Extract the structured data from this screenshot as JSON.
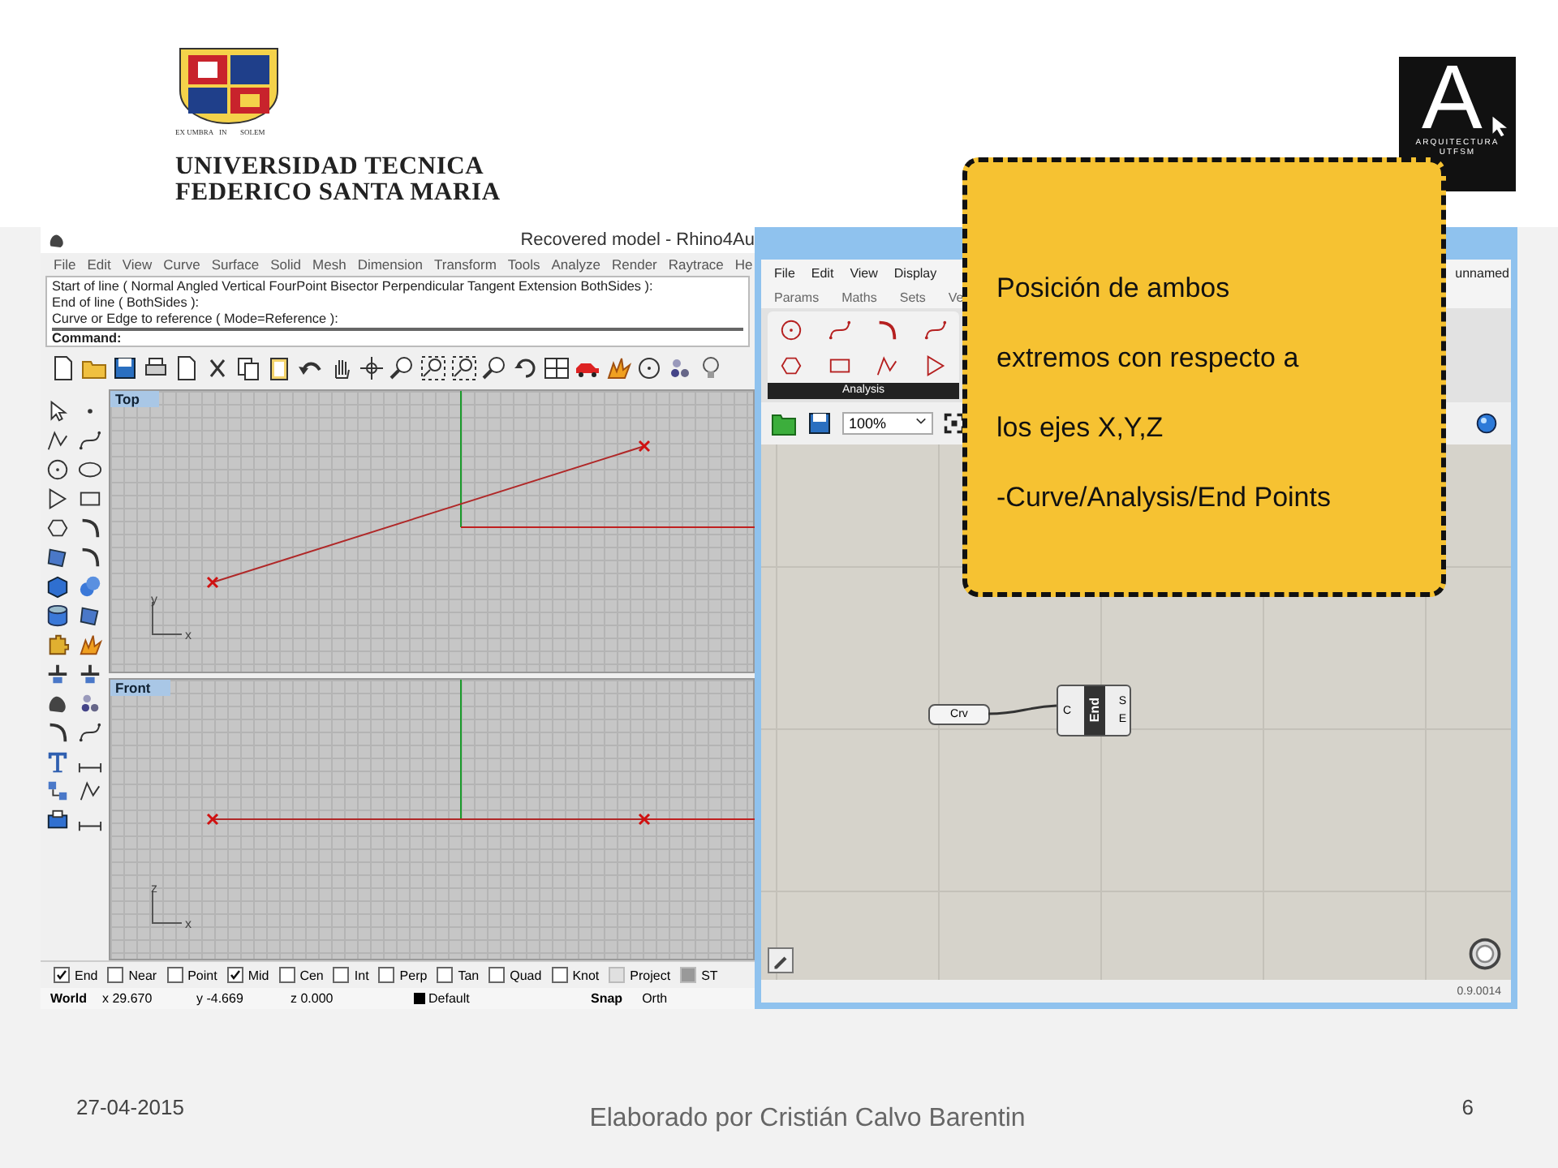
{
  "header": {
    "university_logo": {
      "motto": [
        "EX UMBRA",
        "IN",
        "SOLEM"
      ],
      "lines": [
        "UNIVERSIDAD TECNICA",
        "FEDERICO SANTA MARIA"
      ]
    },
    "school_logo": {
      "letter": "A",
      "lines": [
        "ARQUITECTURA",
        "UTFSM"
      ]
    }
  },
  "rhino": {
    "title": "Recovered model - Rhino4Au",
    "menu": [
      "File",
      "Edit",
      "View",
      "Curve",
      "Surface",
      "Solid",
      "Mesh",
      "Dimension",
      "Transform",
      "Tools",
      "Analyze",
      "Render",
      "Raytrace",
      "He"
    ],
    "command_history": [
      "Start of line ( Normal  Angled  Vertical  FourPoint  Bisector  Perpendicular  Tangent  Extension  BothSides ):",
      "End of line ( BothSides ):",
      "Curve or Edge to reference ( Mode=Reference ):"
    ],
    "command_prompt": "Command:",
    "viewports": [
      {
        "kind": "top",
        "label": "Top",
        "axis_labels": [
          "y",
          "x"
        ]
      },
      {
        "kind": "front",
        "label": "Front",
        "axis_labels": [
          "z",
          "x"
        ]
      }
    ],
    "osnaps": [
      {
        "label": "End",
        "checked": true,
        "disabled": false
      },
      {
        "label": "Near",
        "checked": false,
        "disabled": false
      },
      {
        "label": "Point",
        "checked": false,
        "disabled": false
      },
      {
        "label": "Mid",
        "checked": true,
        "disabled": false
      },
      {
        "label": "Cen",
        "checked": false,
        "disabled": false
      },
      {
        "label": "Int",
        "checked": false,
        "disabled": false
      },
      {
        "label": "Perp",
        "checked": false,
        "disabled": false
      },
      {
        "label": "Tan",
        "checked": false,
        "disabled": false
      },
      {
        "label": "Quad",
        "checked": false,
        "disabled": false
      },
      {
        "label": "Knot",
        "checked": false,
        "disabled": false
      },
      {
        "label": "Project",
        "checked": false,
        "disabled": true
      },
      {
        "label": "ST",
        "checked": true,
        "disabled": true
      }
    ],
    "status_bar": {
      "cplane": "World",
      "x": "x 29.670",
      "y": "y -4.669",
      "z": "z 0.000",
      "layer": "Default",
      "buttons": [
        {
          "label": "Snap",
          "on": true
        },
        {
          "label": "Orth",
          "on": false
        }
      ]
    }
  },
  "grasshopper": {
    "menu": [
      "File",
      "Edit",
      "View",
      "Display"
    ],
    "document_name": "unnamed",
    "tabs": [
      {
        "label": "Params",
        "selected": false
      },
      {
        "label": "Maths",
        "selected": false
      },
      {
        "label": "Sets",
        "selected": false
      },
      {
        "label": "Ve",
        "selected": false
      }
    ],
    "ribbon_group": "Analysis",
    "zoom": "100%",
    "nodes": [
      {
        "kind": "param",
        "label": "Crv"
      },
      {
        "kind": "component",
        "label": "End",
        "inputs": [
          "C"
        ],
        "outputs": [
          "S",
          "E"
        ]
      }
    ],
    "version": "0.9.0014"
  },
  "callout": {
    "lines": [
      "Posición de ambos",
      "extremos con respecto a",
      "los ejes X,Y,Z",
      "-Curve/Analysis/End Points"
    ]
  },
  "footer": {
    "date": "27-04-2015",
    "author": "Elaborado por Cristián Calvo Barentin",
    "page": "6"
  }
}
